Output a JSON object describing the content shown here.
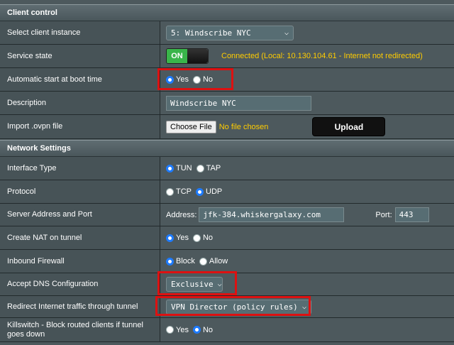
{
  "client_control": {
    "header": "Client control",
    "select_instance": {
      "label": "Select client instance",
      "value": "5: Windscribe NYC"
    },
    "service_state": {
      "label": "Service state",
      "toggle": "ON",
      "status": "Connected (Local: 10.130.104.61 - Internet not redirected)"
    },
    "auto_start": {
      "label": "Automatic start at boot time",
      "yes": "Yes",
      "no": "No",
      "selected": "Yes"
    },
    "description": {
      "label": "Description",
      "value": "Windscribe NYC"
    },
    "import": {
      "label": "Import .ovpn file",
      "choose": "Choose File",
      "nofile": "No file chosen",
      "upload": "Upload"
    }
  },
  "network_settings": {
    "header": "Network Settings",
    "interface": {
      "label": "Interface Type",
      "opt1": "TUN",
      "opt2": "TAP",
      "selected": "TUN"
    },
    "protocol": {
      "label": "Protocol",
      "opt1": "TCP",
      "opt2": "UDP",
      "selected": "UDP"
    },
    "server": {
      "label": "Server Address and Port",
      "address_label": "Address:",
      "address": "jfk-384.whiskergalaxy.com",
      "port_label": "Port:",
      "port": "443"
    },
    "nat": {
      "label": "Create NAT on tunnel",
      "yes": "Yes",
      "no": "No",
      "selected": "Yes"
    },
    "firewall": {
      "label": "Inbound Firewall",
      "opt1": "Block",
      "opt2": "Allow",
      "selected": "Block"
    },
    "dns": {
      "label": "Accept DNS Configuration",
      "value": "Exclusive"
    },
    "redirect": {
      "label": "Redirect Internet traffic through tunnel",
      "value": "VPN Director (policy rules)"
    },
    "killswitch": {
      "label": "Killswitch - Block routed clients if tunnel goes down",
      "yes": "Yes",
      "no": "No",
      "selected": "No"
    }
  },
  "colors": {
    "highlight": "#dd1111",
    "status": "#ffcc00",
    "toggle_on": "#39b54a",
    "radio_checked": "#1d7bff"
  }
}
